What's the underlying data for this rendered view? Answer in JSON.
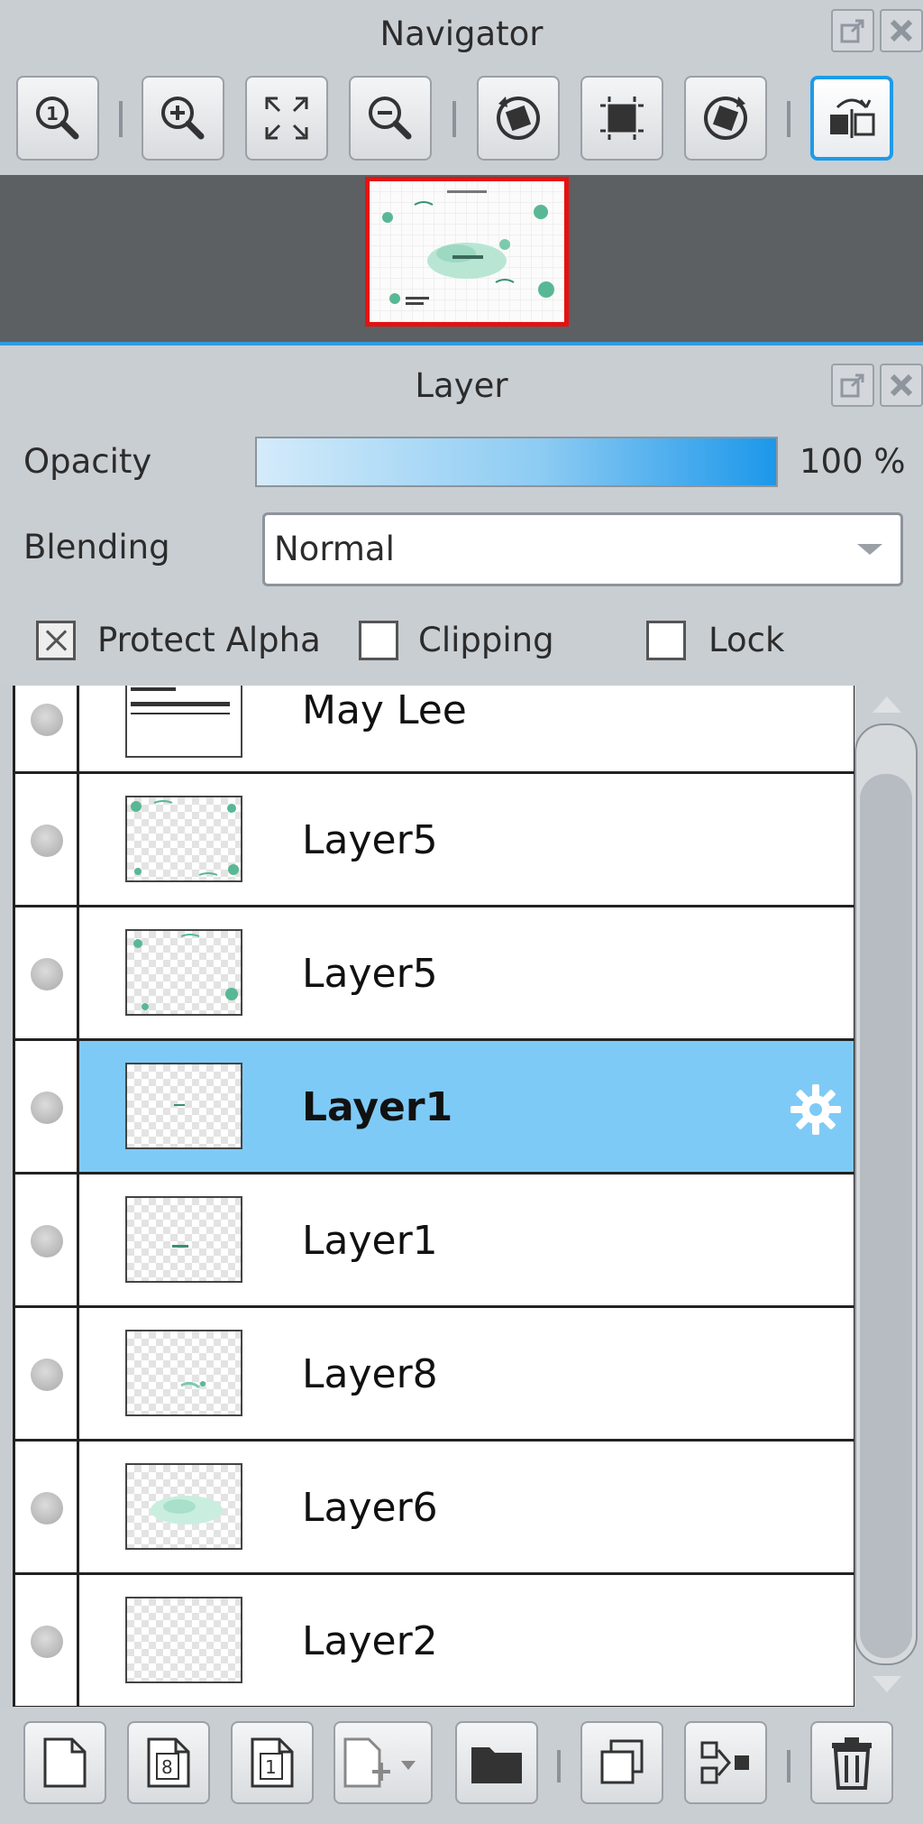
{
  "navigator": {
    "title": "Navigator",
    "tools": [
      {
        "icon": "zoom-actual-size-icon"
      },
      {
        "icon": "zoom-in-icon"
      },
      {
        "icon": "fit-to-window-icon"
      },
      {
        "icon": "zoom-out-icon"
      },
      {
        "icon": "rotate-left-icon"
      },
      {
        "icon": "reset-rotation-icon"
      },
      {
        "icon": "rotate-right-icon"
      },
      {
        "icon": "flip-horizontal-icon",
        "active": true
      }
    ]
  },
  "layer_panel": {
    "title": "Layer",
    "opacity_label": "Opacity",
    "opacity_value": "100 %",
    "opacity_fraction": 1.0,
    "blending_label": "Blending",
    "blending_value": "Normal",
    "protect_alpha_label": "Protect Alpha",
    "clipping_label": "Clipping",
    "lock_label": "Lock",
    "layers": [
      {
        "name": "May Lee",
        "selected": false
      },
      {
        "name": "Layer5",
        "selected": false
      },
      {
        "name": "Layer5",
        "selected": false
      },
      {
        "name": "Layer1",
        "selected": true
      },
      {
        "name": "Layer1",
        "selected": false
      },
      {
        "name": "Layer8",
        "selected": false
      },
      {
        "name": "Layer6",
        "selected": false
      },
      {
        "name": "Layer2",
        "selected": false
      }
    ]
  },
  "colors": {
    "selection": "#7ecaf7",
    "accent": "#1e9be8",
    "preview_border": "#e81010"
  }
}
